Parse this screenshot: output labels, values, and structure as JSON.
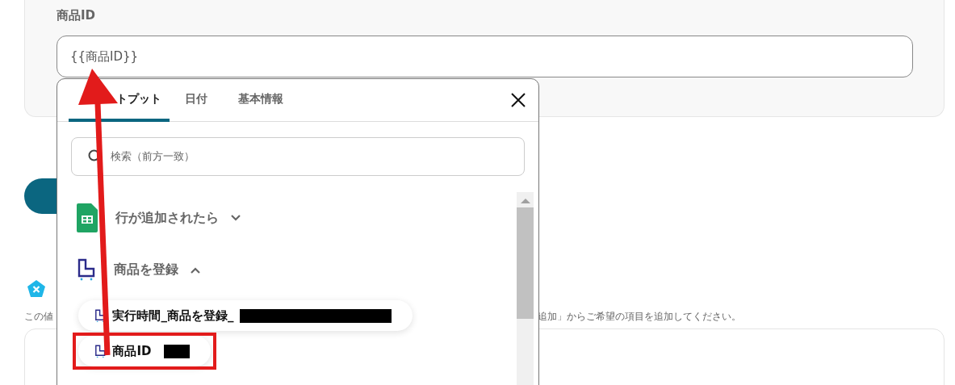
{
  "field": {
    "label": "商品ID",
    "value": "{{商品ID}}"
  },
  "description": {
    "visible_start": "この値",
    "visible_end": "追加」からご希望の項目を追加してください。"
  },
  "picker": {
    "tabs": [
      {
        "label": "トプット",
        "selected": true
      },
      {
        "label": "日付",
        "selected": false
      },
      {
        "label": "基本情報",
        "selected": false
      }
    ],
    "search": {
      "placeholder": "検索（前方一致）"
    },
    "groups": [
      {
        "kind": "sheet",
        "title": "行が追加されたら",
        "expanded": false
      },
      {
        "kind": "cart",
        "title": "商品を登録",
        "expanded": true,
        "items": [
          {
            "text": "実行時間_商品を登録_",
            "redacted": true,
            "wide_redaction": true,
            "highlighted": false
          },
          {
            "text": "商品ID",
            "redacted": true,
            "wide_redaction": false,
            "highlighted": true
          }
        ]
      }
    ]
  }
}
